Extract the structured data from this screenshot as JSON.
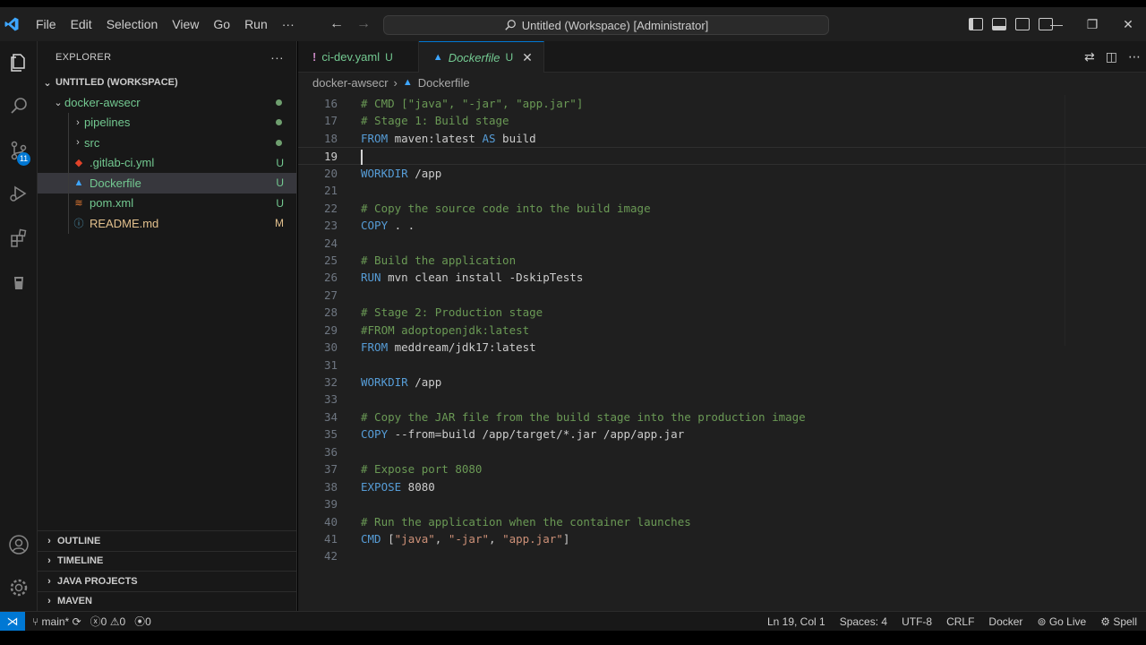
{
  "menu": [
    "File",
    "Edit",
    "Selection",
    "View",
    "Go",
    "Run",
    "···"
  ],
  "command_center": "Untitled (Workspace) [Administrator]",
  "sidebar": {
    "header": "EXPLORER",
    "more": "···",
    "workspace": "UNTITLED (WORKSPACE)",
    "tree": [
      {
        "label": "docker-awsecr",
        "type": "folder-open",
        "status": "",
        "depth": 1
      },
      {
        "label": "pipelines",
        "type": "folder",
        "status": "",
        "depth": 2
      },
      {
        "label": "src",
        "type": "folder",
        "status": "",
        "depth": 2
      },
      {
        "label": ".gitlab-ci.yml",
        "type": "gitlab-file",
        "status": "U",
        "depth": 2
      },
      {
        "label": "Dockerfile",
        "type": "docker-file",
        "status": "U",
        "depth": 2,
        "selected": true
      },
      {
        "label": "pom.xml",
        "type": "xml-file",
        "status": "U",
        "depth": 2
      },
      {
        "label": "README.md",
        "type": "info-file",
        "status": "M",
        "depth": 2
      }
    ],
    "sections": [
      "OUTLINE",
      "TIMELINE",
      "JAVA PROJECTS",
      "MAVEN"
    ]
  },
  "activity_badge": "11",
  "tabs": [
    {
      "prefix": "!",
      "name": "ci-dev.yaml",
      "status": "U"
    },
    {
      "name": "Dockerfile",
      "status": "U",
      "active": true
    }
  ],
  "breadcrumb": {
    "folder": "docker-awsecr",
    "file": "Dockerfile"
  },
  "code": [
    {
      "n": "16",
      "tokens": [
        [
          "cm",
          "# CMD [\"java\", \"-jar\", \"app.jar\"]"
        ]
      ]
    },
    {
      "n": "17",
      "tokens": [
        [
          "cm",
          "# Stage 1: Build stage"
        ]
      ]
    },
    {
      "n": "18",
      "tokens": [
        [
          "kw",
          "FROM"
        ],
        [
          "pl",
          " maven:latest "
        ],
        [
          "kw",
          "AS"
        ],
        [
          "pl",
          " build"
        ]
      ]
    },
    {
      "n": "19",
      "tokens": [],
      "current": true
    },
    {
      "n": "20",
      "tokens": [
        [
          "kw",
          "WORKDIR"
        ],
        [
          "pl",
          " /app"
        ]
      ]
    },
    {
      "n": "21",
      "tokens": []
    },
    {
      "n": "22",
      "tokens": [
        [
          "cm",
          "# Copy the source code into the build image"
        ]
      ]
    },
    {
      "n": "23",
      "tokens": [
        [
          "kw",
          "COPY"
        ],
        [
          "pl",
          " . ."
        ]
      ]
    },
    {
      "n": "24",
      "tokens": []
    },
    {
      "n": "25",
      "tokens": [
        [
          "cm",
          "# Build the application"
        ]
      ]
    },
    {
      "n": "26",
      "tokens": [
        [
          "kw",
          "RUN"
        ],
        [
          "pl",
          " mvn clean install -DskipTests"
        ]
      ]
    },
    {
      "n": "27",
      "tokens": []
    },
    {
      "n": "28",
      "tokens": [
        [
          "cm",
          "# Stage 2: Production stage"
        ]
      ]
    },
    {
      "n": "29",
      "tokens": [
        [
          "cm",
          "#FROM adoptopenjdk:latest"
        ]
      ]
    },
    {
      "n": "30",
      "tokens": [
        [
          "kw",
          "FROM"
        ],
        [
          "pl",
          " meddream/jdk17:latest"
        ]
      ]
    },
    {
      "n": "31",
      "tokens": []
    },
    {
      "n": "32",
      "tokens": [
        [
          "kw",
          "WORKDIR"
        ],
        [
          "pl",
          " /app"
        ]
      ]
    },
    {
      "n": "33",
      "tokens": []
    },
    {
      "n": "34",
      "tokens": [
        [
          "cm",
          "# Copy the JAR file from the build stage into the production image"
        ]
      ]
    },
    {
      "n": "35",
      "tokens": [
        [
          "kw",
          "COPY"
        ],
        [
          "pl",
          " --from=build /app/target/*.jar /app/app.jar"
        ]
      ]
    },
    {
      "n": "36",
      "tokens": []
    },
    {
      "n": "37",
      "tokens": [
        [
          "cm",
          "# Expose port 8080"
        ]
      ]
    },
    {
      "n": "38",
      "tokens": [
        [
          "kw",
          "EXPOSE"
        ],
        [
          "pl",
          " 8080"
        ]
      ]
    },
    {
      "n": "39",
      "tokens": []
    },
    {
      "n": "40",
      "tokens": [
        [
          "cm",
          "# Run the application when the container launches"
        ]
      ]
    },
    {
      "n": "41",
      "tokens": [
        [
          "kw",
          "CMD"
        ],
        [
          "pl",
          " ["
        ],
        [
          "str",
          "\"java\""
        ],
        [
          "pl",
          ", "
        ],
        [
          "str",
          "\"-jar\""
        ],
        [
          "pl",
          ", "
        ],
        [
          "str",
          "\"app.jar\""
        ],
        [
          "pl",
          "]"
        ]
      ]
    },
    {
      "n": "42",
      "tokens": []
    }
  ],
  "status": {
    "branch": "main*",
    "errors": "0",
    "warnings": "0",
    "ports": "0",
    "position": "Ln 19, Col 1",
    "spaces": "Spaces: 4",
    "encoding": "UTF-8",
    "eol": "CRLF",
    "language": "Docker",
    "golive": "Go Live",
    "spell": "Spell"
  },
  "colors": {
    "accent": "#0078d4",
    "untracked": "#73c991",
    "modified": "#e2c08d"
  }
}
